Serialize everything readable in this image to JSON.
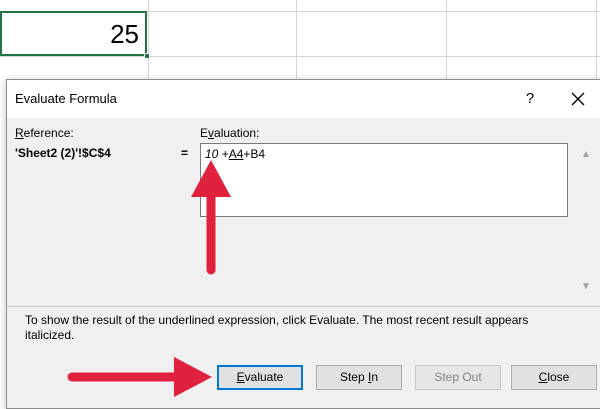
{
  "cell": {
    "value": "25"
  },
  "dialog": {
    "title": "Evaluate Formula",
    "help_label": "?",
    "reference_label_prefix": "R",
    "reference_label_rest": "eference:",
    "evaluation_label_prefix": "E",
    "evaluation_label_mid": "v",
    "evaluation_label_rest": "aluation:",
    "reference_value": "'Sheet2 (2)'!$C$4",
    "equals": "=",
    "expression": {
      "result_part": "10",
      "op1": " +",
      "underlined_part": "A4",
      "rest": "+B4"
    },
    "info_text": "To show the result of the underlined expression, click Evaluate.  The most recent result appears italicized.",
    "buttons": {
      "evaluate_u": "E",
      "evaluate_rest": "valuate",
      "stepin_pre": "Step ",
      "stepin_u": "I",
      "stepin_rest": "n",
      "stepout": "Step Out",
      "close_u": "C",
      "close_rest": "lose"
    }
  },
  "colors": {
    "annotation_arrow": "#e0213d",
    "default_button_border": "#0078d7",
    "active_cell_border": "#217346"
  }
}
